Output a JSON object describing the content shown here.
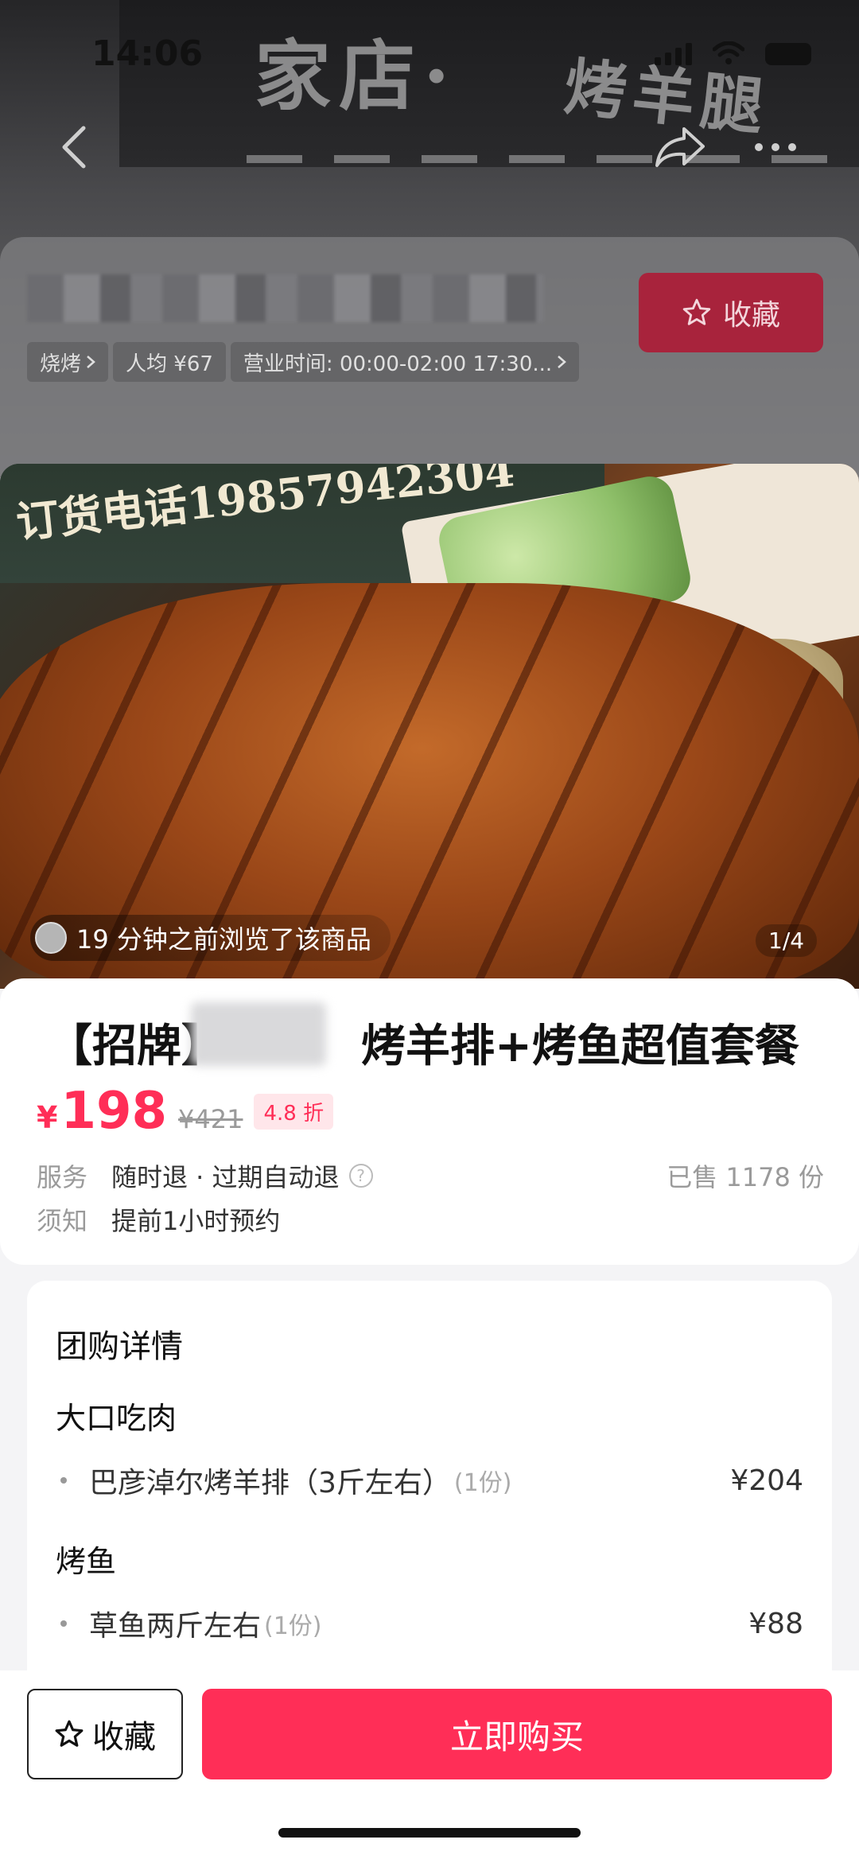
{
  "status_bar": {
    "time": "14:06"
  },
  "store": {
    "sign_text_1": "家店·",
    "sign_text_2": "烤羊腿",
    "favorite_label": "收藏",
    "tags": [
      "烧烤",
      "人均 ¥67",
      "营业时间: 00:00-02:00 17:30..."
    ]
  },
  "hero": {
    "phone_text": "订货电话19857942304",
    "viewer_text": "19 分钟之前浏览了该商品",
    "page_indicator": "1/4"
  },
  "product": {
    "title_prefix": "【招牌】",
    "title_suffix": "烤羊排+烤鱼超值套餐",
    "currency": "¥",
    "price": "198",
    "original_price": "¥421",
    "discount": "4.8 折",
    "service_label": "服务",
    "service_value": "随时退 · 过期自动退",
    "sold": "已售 1178 份",
    "notice_label": "须知",
    "notice_value": "提前1小时预约"
  },
  "details": {
    "title": "团购详情",
    "sections": [
      {
        "name": "大口吃肉",
        "items": [
          {
            "name": "巴彦淖尔烤羊排（3斤左右）",
            "qty": "(1份)",
            "price": "¥204"
          }
        ]
      },
      {
        "name": "烤鱼",
        "items": [
          {
            "name": "草鱼两斤左右",
            "qty": "(1份)",
            "price": "¥88"
          }
        ]
      }
    ]
  },
  "bottom": {
    "favorite_label": "收藏",
    "buy_label": "立即购买"
  },
  "colors": {
    "accent": "#ff2e57",
    "accent_dim": "#a8233c"
  }
}
